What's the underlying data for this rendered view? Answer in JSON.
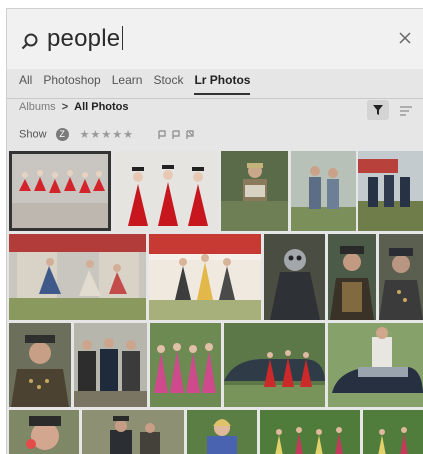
{
  "search": {
    "query": "people"
  },
  "tabs": [
    {
      "label": "All"
    },
    {
      "label": "Photoshop"
    },
    {
      "label": "Learn"
    },
    {
      "label": "Stock"
    },
    {
      "label": "Lr Photos",
      "active": true
    }
  ],
  "breadcrumb": {
    "root": "Albums",
    "separator": ">",
    "current": "All Photos"
  },
  "filter_row": {
    "show_label": "Show",
    "stars": "★★★★★"
  },
  "photos": [
    {
      "subject": "dancers in red dresses on stage",
      "selected": true
    },
    {
      "subject": "three women in red dresses and hats"
    },
    {
      "subject": "man playing accordion"
    },
    {
      "subject": "men in vintage costume outdoors"
    },
    {
      "subject": "military uniform parade crowd"
    },
    {
      "subject": "people sitting in front of tents"
    },
    {
      "subject": "costumed performers under canopy"
    },
    {
      "subject": "steampunk figure with goggles"
    },
    {
      "subject": "man in steampunk hat and jacket"
    },
    {
      "subject": "bearded man in military hat"
    },
    {
      "subject": "bearded man with cap"
    },
    {
      "subject": "men in suits crowd"
    },
    {
      "subject": "women in pink dresses"
    },
    {
      "subject": "dancers in red by vintage car"
    },
    {
      "subject": "man by vintage car"
    },
    {
      "subject": "man blowing whistle"
    },
    {
      "subject": "men in hats"
    },
    {
      "subject": "woman in blue outdoors"
    },
    {
      "subject": "dancers on grass field"
    },
    {
      "subject": "dancers on lawn"
    }
  ],
  "colors": {
    "panel": "#e6e6e6",
    "search_bg": "#f1f1f1",
    "accent_dark": "#333333"
  }
}
